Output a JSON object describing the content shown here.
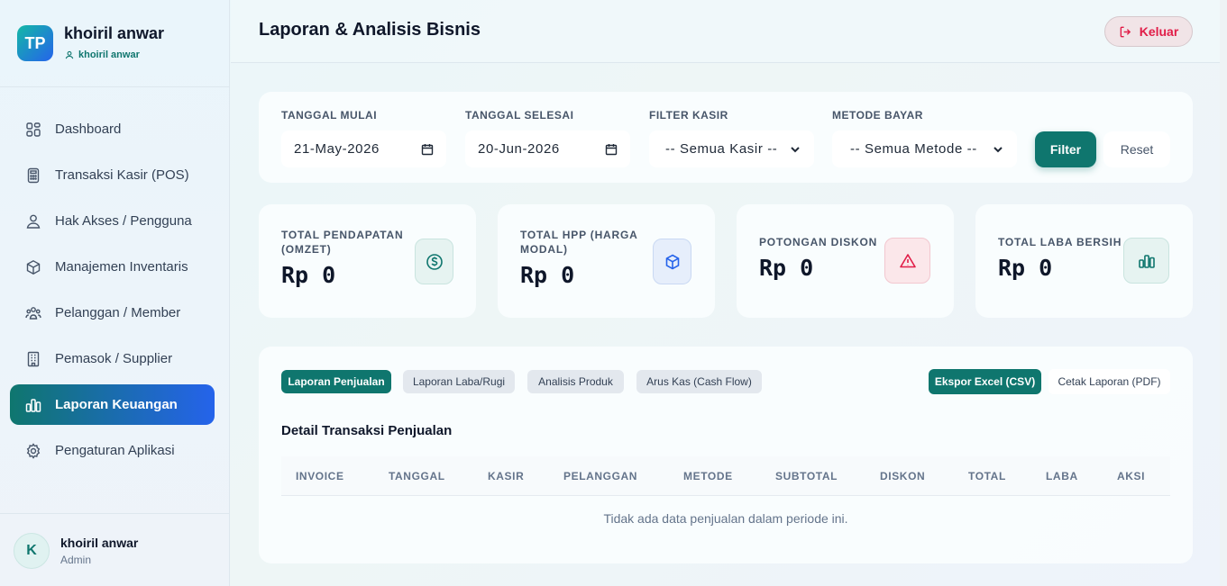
{
  "brand": {
    "logo": "TP",
    "name": "khoiril anwar",
    "sub": "khoiril anwar"
  },
  "nav": [
    {
      "label": "Dashboard",
      "icon": "grid-icon"
    },
    {
      "label": "Transaksi Kasir (POS)",
      "icon": "calculator-icon"
    },
    {
      "label": "Hak Akses / Pengguna",
      "icon": "users-icon"
    },
    {
      "label": "Manajemen Inventaris",
      "icon": "box-icon"
    },
    {
      "label": "Pelanggan / Member",
      "icon": "group-icon"
    },
    {
      "label": "Pemasok / Supplier",
      "icon": "building-icon"
    },
    {
      "label": "Laporan Keuangan",
      "icon": "chart-icon",
      "active": true
    },
    {
      "label": "Pengaturan Aplikasi",
      "icon": "gear-icon"
    }
  ],
  "user": {
    "initial": "K",
    "name": "khoiril anwar",
    "role": "Admin"
  },
  "header": {
    "title": "Laporan & Analisis Bisnis",
    "logout": "Keluar"
  },
  "filters": {
    "start_label": "TANGGAL MULAI",
    "start_value": "21-May-2026",
    "end_label": "TANGGAL SELESAI",
    "end_value": "20-Jun-2026",
    "cashier_label": "FILTER KASIR",
    "cashier_value": "-- Semua Kasir --",
    "method_label": "METODE BAYAR",
    "method_value": "-- Semua Metode --",
    "filter_btn": "Filter",
    "reset_btn": "Reset"
  },
  "stats": [
    {
      "label": "TOTAL PENDAPATAN (OMZET)",
      "value": "Rp 0",
      "icon": "dollar-icon"
    },
    {
      "label": "TOTAL HPP (HARGA MODAL)",
      "value": "Rp 0",
      "icon": "cube-icon"
    },
    {
      "label": "POTONGAN DISKON",
      "value": "Rp 0",
      "icon": "warning-icon"
    },
    {
      "label": "TOTAL LABA BERSIH",
      "value": "Rp 0",
      "icon": "bar-chart-icon"
    }
  ],
  "tabs": [
    "Laporan Penjualan",
    "Laporan Laba/Rugi",
    "Analisis Produk",
    "Arus Kas (Cash Flow)"
  ],
  "export": {
    "excel": "Ekspor Excel (CSV)",
    "pdf": "Cetak Laporan (PDF)"
  },
  "table": {
    "title": "Detail Transaksi Penjualan",
    "columns": [
      "INVOICE",
      "TANGGAL",
      "KASIR",
      "PELANGGAN",
      "METODE",
      "SUBTOTAL",
      "DISKON",
      "TOTAL",
      "LABA",
      "AKSI"
    ],
    "empty": "Tidak ada data penjualan dalam periode ini."
  },
  "colors": {
    "accent": "#0f766e",
    "accent2": "#2563eb",
    "danger": "#e11d48"
  }
}
